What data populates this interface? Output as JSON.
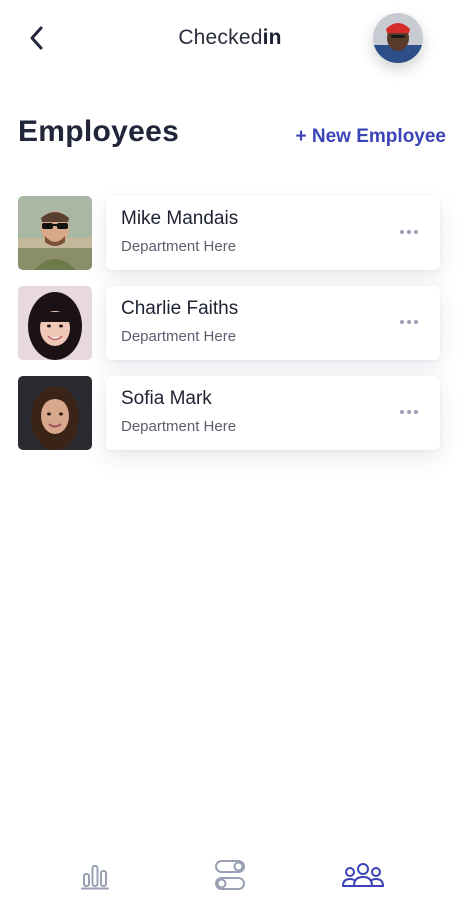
{
  "header": {
    "brand_regular": "Checked",
    "brand_bold": "in",
    "back_icon": "chevron-left-icon",
    "avatar": "user-avatar"
  },
  "page": {
    "title": "Employees",
    "new_employee_label": "+ New Employee"
  },
  "employees": [
    {
      "name": "Mike Mandais",
      "department": "Department Here",
      "photo": "man-sunglasses-photo"
    },
    {
      "name": "Charlie Faiths",
      "department": "Department Here",
      "photo": "woman-bangs-photo"
    },
    {
      "name": "Sofia Mark",
      "department": "Department Here",
      "photo": "woman-dark-hair-photo"
    }
  ],
  "nav": {
    "items": [
      {
        "icon": "bar-chart-icon",
        "active": false
      },
      {
        "icon": "toggles-icon",
        "active": false
      },
      {
        "icon": "users-group-icon",
        "active": true
      }
    ],
    "active_color": "#3b44b7",
    "inactive_color": "#9aa0b4"
  },
  "colors": {
    "accent": "#3b44b7",
    "text": "#1f2233",
    "muted": "#5c5f6e"
  }
}
